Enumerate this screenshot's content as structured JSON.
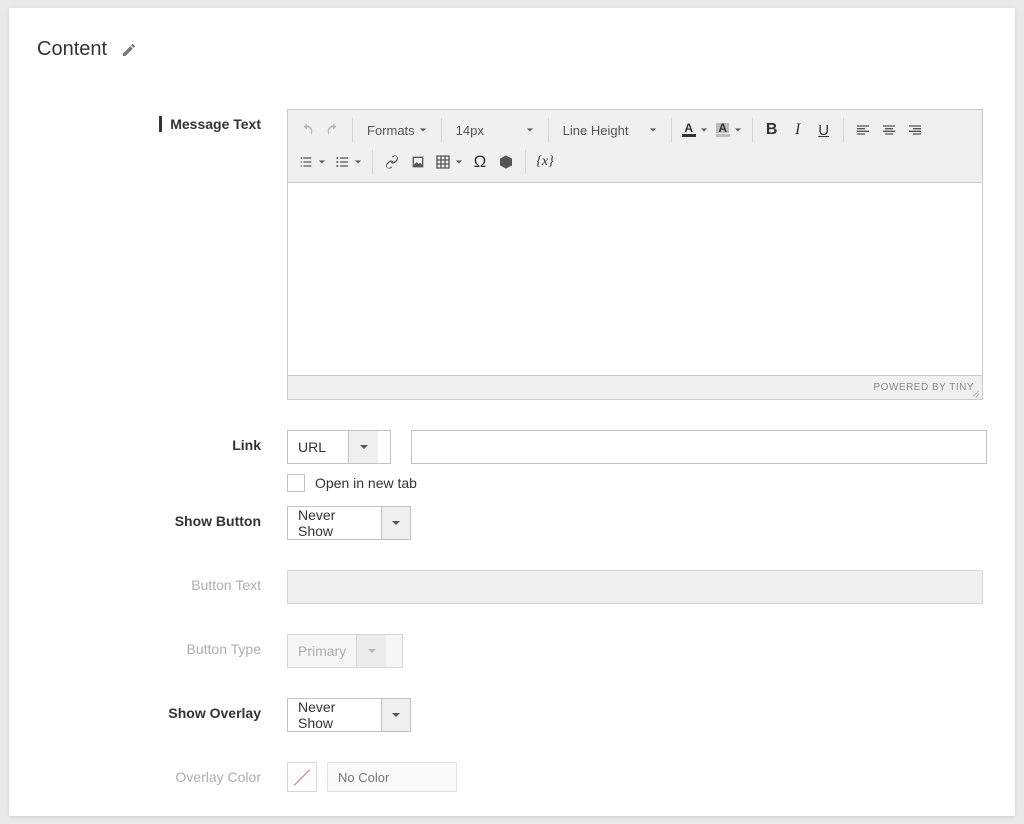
{
  "panel": {
    "title": "Content"
  },
  "fields": {
    "message_text_label": "Message Text",
    "link_label": "Link",
    "link_type": "URL",
    "link_url": "",
    "open_new_tab_label": "Open in new tab",
    "show_button_label": "Show Button",
    "show_button_value": "Never Show",
    "button_text_label": "Button Text",
    "button_text_value": "",
    "button_type_label": "Button Type",
    "button_type_value": "Primary",
    "show_overlay_label": "Show Overlay",
    "show_overlay_value": "Never Show",
    "overlay_color_label": "Overlay Color",
    "overlay_color_placeholder": "No Color"
  },
  "editor": {
    "formats_label": "Formats",
    "fontsize_label": "14px",
    "lineheight_label": "Line Height",
    "status": "POWERED BY TINY"
  }
}
